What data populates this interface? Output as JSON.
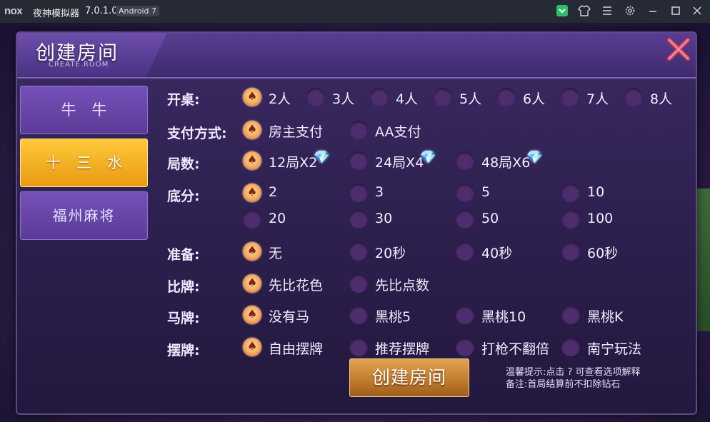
{
  "window": {
    "logo_text": "nox",
    "title": "夜神模拟器",
    "version": "7.0.1.0",
    "android_badge": "Android 7",
    "icons": [
      "brand-icon",
      "shirt-icon",
      "menu-icon",
      "gear-icon",
      "minimize-icon",
      "maximize-icon",
      "close-icon"
    ]
  },
  "dialog": {
    "title": "创建房间",
    "subtitle": "CREATE ROOM",
    "close_icon": "red-x-icon"
  },
  "side_menu": {
    "items": [
      {
        "label": "牛牛",
        "active": false
      },
      {
        "label": "十三水",
        "active": true
      },
      {
        "label": "福州麻将",
        "active": false
      }
    ]
  },
  "rows": {
    "players": {
      "label": "开桌:",
      "options": [
        "2人",
        "3人",
        "4人",
        "5人",
        "6人",
        "7人",
        "8人"
      ],
      "selected": 0
    },
    "payment": {
      "label": "支付方式:",
      "options": [
        "房主支付",
        "AA支付"
      ],
      "selected": 0
    },
    "rounds": {
      "label": "局数:",
      "options": [
        "12局X2",
        "24局X4",
        "48局X6"
      ],
      "selected": 0,
      "gem_icon": "diamond-icon"
    },
    "base_score": {
      "label": "底分:",
      "options": [
        "2",
        "3",
        "5",
        "10",
        "20",
        "30",
        "50",
        "100"
      ],
      "selected": 0
    },
    "ready": {
      "label": "准备:",
      "options": [
        "无",
        "20秒",
        "40秒",
        "60秒"
      ],
      "selected": 0
    },
    "compare": {
      "label": "比牌:",
      "options": [
        "先比花色",
        "先比点数"
      ],
      "selected": 0
    },
    "horse": {
      "label": "马牌:",
      "options": [
        "没有马",
        "黑桃5",
        "黑桃10",
        "黑桃K"
      ],
      "selected": 0
    },
    "arrange": {
      "label": "摆牌:",
      "options": [
        "自由摆牌",
        "推荐摆牌",
        "打枪不翻倍",
        "南宁玩法"
      ],
      "selected": 0
    }
  },
  "create_button": {
    "label": "创建房间"
  },
  "notes": {
    "hint": "温馨提示:点击 ? 可查看选项解释",
    "remark": "备注:首局结算前不扣除钻石"
  },
  "colors": {
    "accent_gold": "#f2b23a",
    "dialog_purple": "#3c2a63",
    "close_red": "#e0465a"
  }
}
